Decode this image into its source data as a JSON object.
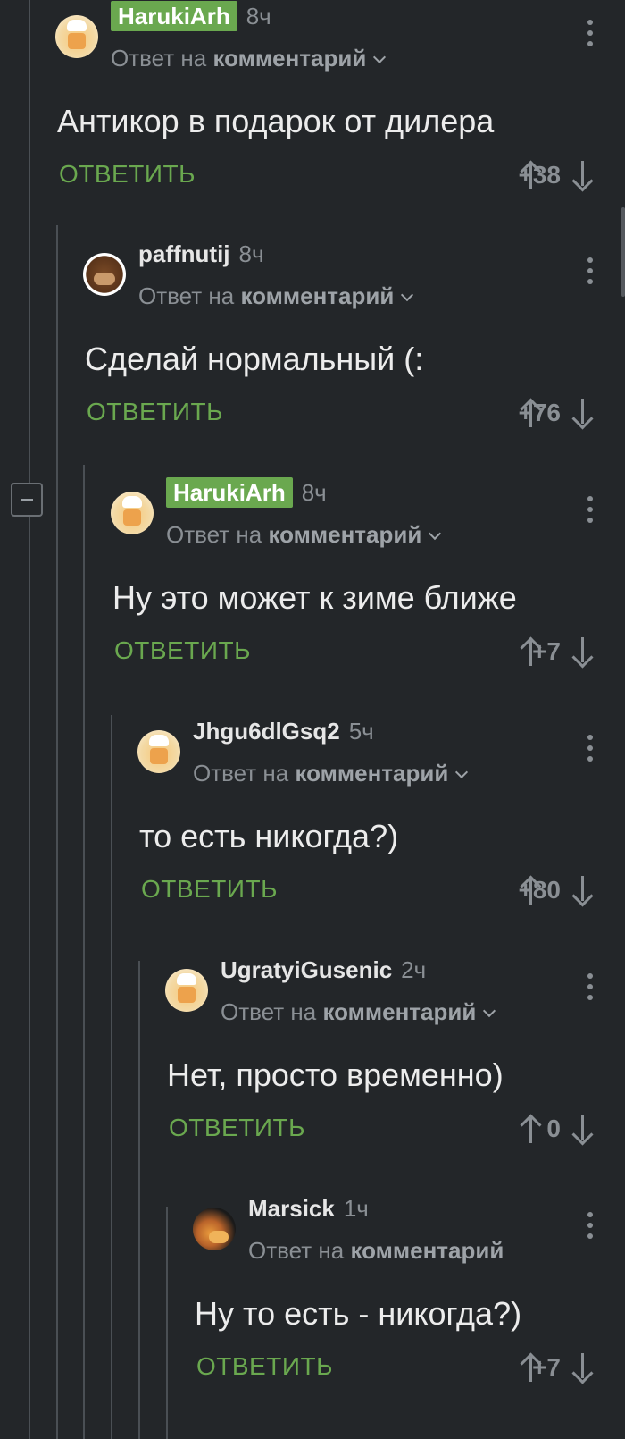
{
  "reply_to_prefix": "Ответ на",
  "reply_to_link": "комментарий",
  "reply_action": "ОТВЕТИТЬ",
  "comments": [
    {
      "username": "HarukiArh",
      "author_badge": true,
      "time": "8ч",
      "text": "Антикор в подарок от дилера",
      "score": "+38",
      "avatar": "chef-avatar",
      "has_dropdown": true
    },
    {
      "username": "paffnutij",
      "author_badge": false,
      "time": "8ч",
      "text": "Сделай нормальный (:",
      "score": "+76",
      "avatar": "bear-avatar",
      "has_dropdown": true
    },
    {
      "username": "HarukiArh",
      "author_badge": true,
      "time": "8ч",
      "text": "Ну это может к зиме ближе",
      "score": "+7",
      "avatar": "chef-avatar",
      "has_dropdown": true
    },
    {
      "username": "Jhgu6dlGsq2",
      "author_badge": false,
      "time": "5ч",
      "text": "то есть никогда?)",
      "score": "+80",
      "avatar": "chef-avatar",
      "has_dropdown": true
    },
    {
      "username": "UgratyiGusenic",
      "author_badge": false,
      "time": "2ч",
      "text": "Нет, просто временно)",
      "score": "0",
      "avatar": "chef-avatar",
      "has_dropdown": true
    },
    {
      "username": "Marsick",
      "author_badge": false,
      "time": "1ч",
      "text": "Ну то есть - никогда?)",
      "score": "+7",
      "avatar": "photo-avatar",
      "has_dropdown": false
    }
  ],
  "colors": {
    "background": "#232629",
    "accent_green": "#6aa84f",
    "muted": "#8a8f94",
    "text": "#ececec"
  }
}
